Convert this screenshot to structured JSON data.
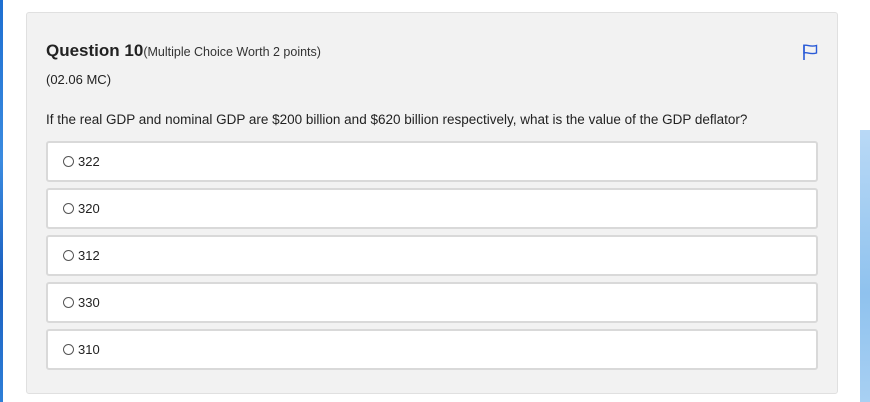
{
  "question": {
    "title": "Question 10",
    "worth": "(Multiple Choice Worth 2 points)",
    "code": "(02.06 MC)",
    "text": "If the real GDP and nominal GDP are $200 billion and $620 billion respectively, what is the value of the GDP deflator?",
    "flag_icon": "flag-icon",
    "options": [
      {
        "label": "322"
      },
      {
        "label": "320"
      },
      {
        "label": "312"
      },
      {
        "label": "330"
      },
      {
        "label": "310"
      }
    ]
  },
  "colors": {
    "flag": "#2a5bd7",
    "card_background": "#f2f2f2",
    "option_border": "#d9d9d9"
  }
}
